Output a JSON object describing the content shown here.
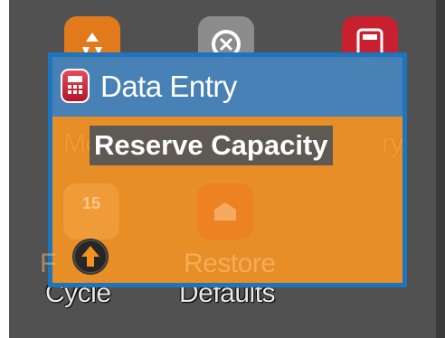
{
  "background": {
    "row1_labels": [
      "Mo",
      "ry"
    ],
    "row2_labels": [
      "Cycle",
      "Defaults"
    ],
    "faded_row2_labels": [
      "F",
      "Restore"
    ],
    "faded_tile_text": "15"
  },
  "dialog": {
    "title": "Data Entry",
    "value": "Reserve Capacity",
    "icon": "calculator-icon"
  },
  "controls": {
    "up_icon": "up-arrow-icon"
  },
  "colors": {
    "dialog_border": "#1d75bf",
    "dialog_header": "#3a80c1",
    "dialog_body": "#f29223",
    "screen_background": "#515151",
    "value_box": "#5e5953"
  }
}
